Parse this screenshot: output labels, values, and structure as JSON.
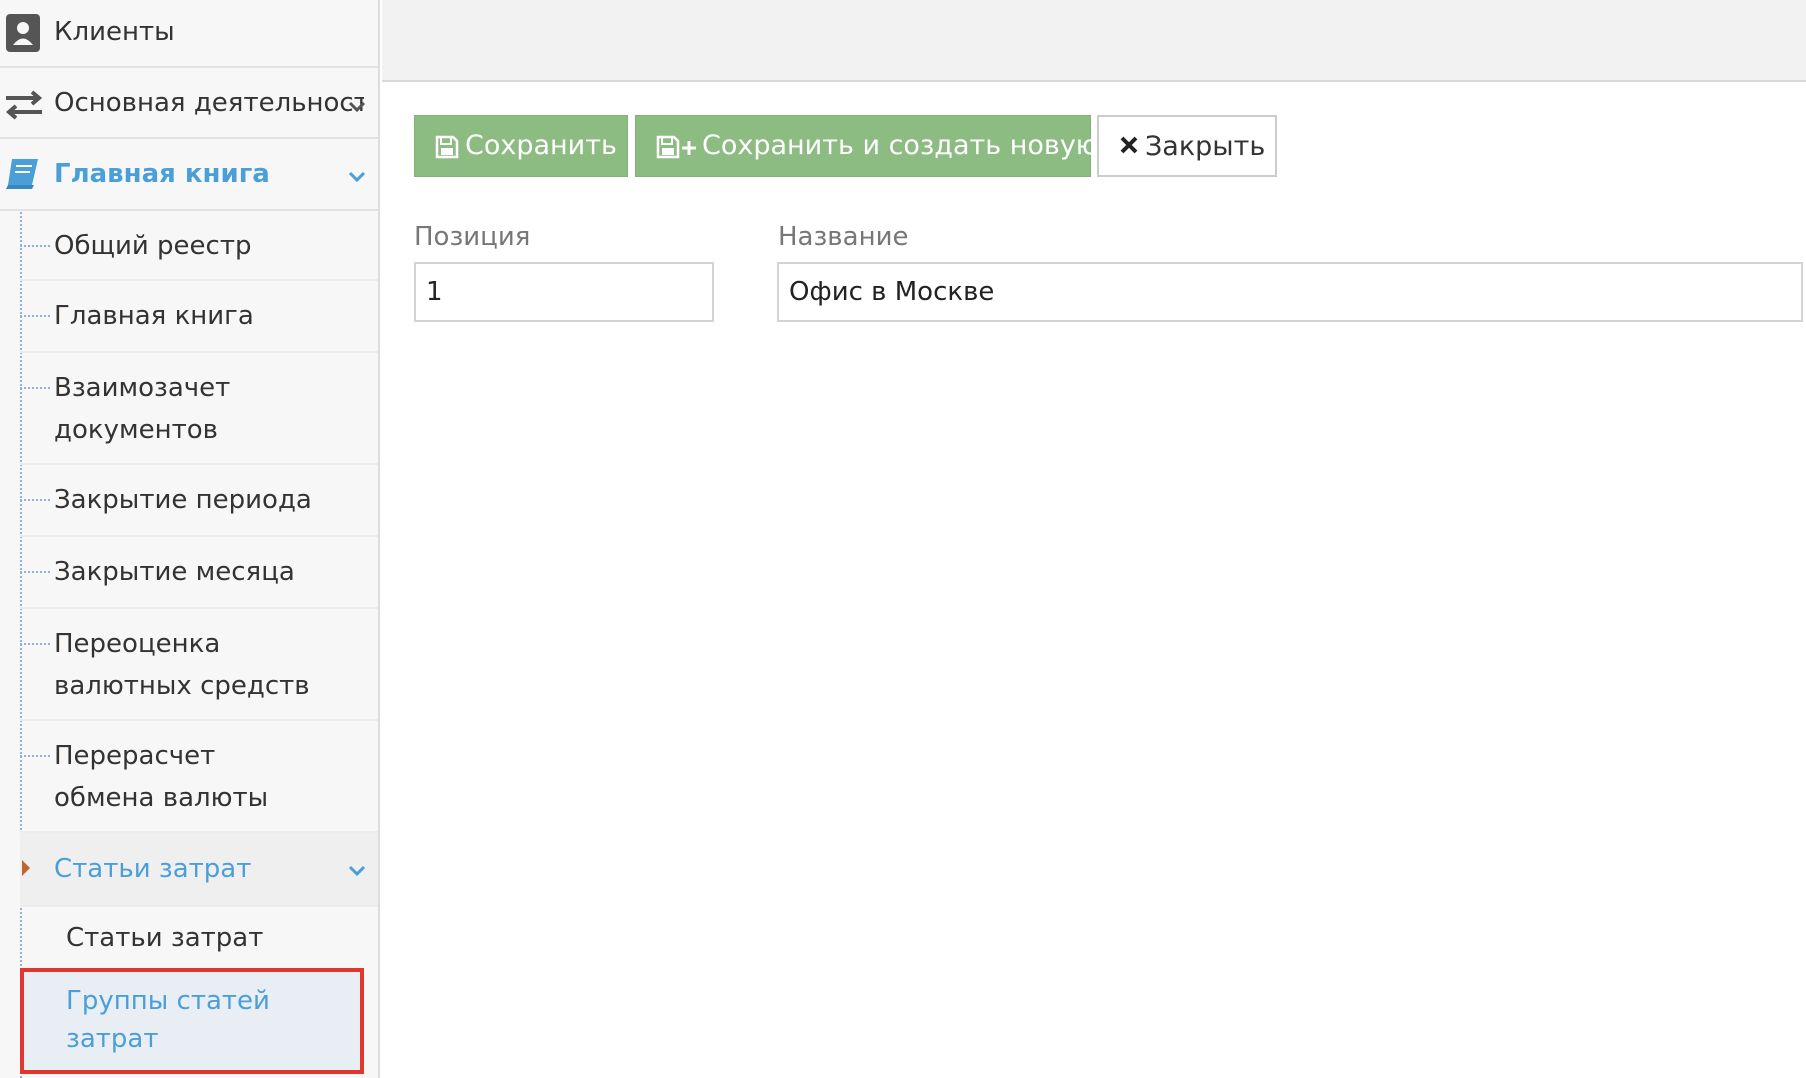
{
  "sidebar": {
    "clients": "Клиенты",
    "main_activity": "Основная деятельность",
    "general_ledger_group": "Главная книга",
    "items": [
      {
        "label": "Общий реестр"
      },
      {
        "label": "Главная книга"
      },
      {
        "label": "Взаимозачет документов"
      },
      {
        "label": "Закрытие периода"
      },
      {
        "label": "Закрытие месяца"
      },
      {
        "label": "Переоценка валютных средств"
      },
      {
        "label": "Перерасчет обмена валюты"
      }
    ],
    "cost_items_group": "Статьи затрат",
    "cost_items_sub": [
      {
        "label": "Статьи затрат"
      },
      {
        "label": "Группы статей затрат"
      }
    ],
    "active_color": "#4a9fd8",
    "highlight_color": "#e0382e"
  },
  "toolbar": {
    "save": "Сохранить",
    "save_new": "Сохранить и создать новую",
    "close": "Закрыть",
    "green": "#8dbc82"
  },
  "form": {
    "position_label": "Позиция",
    "position_value": "1",
    "name_label": "Название",
    "name_value": "Офис в Москве"
  }
}
